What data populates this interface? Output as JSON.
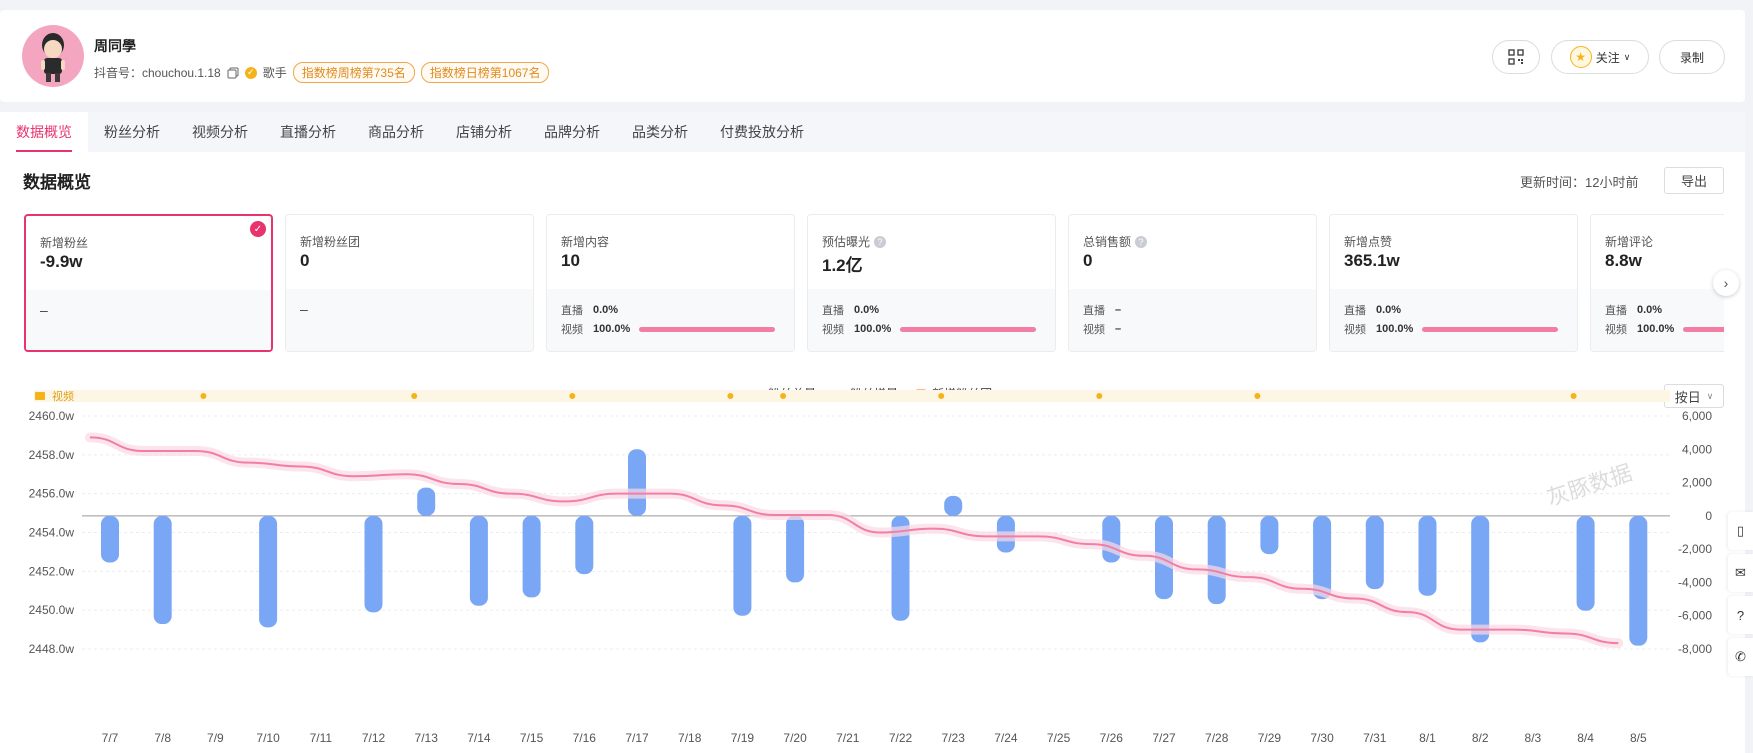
{
  "profile": {
    "name": "周同學",
    "douyin_id": "抖音号：chouchou.1.18",
    "role": "歌手",
    "rank_weekly": "指数榜周榜第735名",
    "rank_daily": "指数榜日榜第1067名",
    "follow_label": "关注",
    "record_label": "录制"
  },
  "tabs": [
    "数据概览",
    "粉丝分析",
    "视频分析",
    "直播分析",
    "商品分析",
    "店铺分析",
    "品牌分析",
    "品类分析",
    "付费投放分析"
  ],
  "overview": {
    "title": "数据概览",
    "update_time": "更新时间：12小时前",
    "export_label": "导出",
    "cards": [
      {
        "label": "新增粉丝",
        "value": "-9.9w",
        "bottom": "–",
        "help": false
      },
      {
        "label": "新增粉丝团",
        "value": "0",
        "bottom": "–",
        "help": false
      },
      {
        "label": "新增内容",
        "value": "10",
        "live_label": "直播",
        "live": "0.0%",
        "video_label": "视频",
        "video": "100.0%",
        "help": false,
        "bar": true
      },
      {
        "label": "预估曝光",
        "value": "1.2亿",
        "live_label": "直播",
        "live": "0.0%",
        "video_label": "视频",
        "video": "100.0%",
        "help": true,
        "bar": true
      },
      {
        "label": "总销售额",
        "value": "0",
        "live_label": "直播",
        "live": "–",
        "video_label": "视频",
        "video": "–",
        "help": true,
        "bar": false
      },
      {
        "label": "新增点赞",
        "value": "365.1w",
        "live_label": "直播",
        "live": "0.0%",
        "video_label": "视频",
        "video": "100.0%",
        "help": false,
        "bar": true
      },
      {
        "label": "新增评论",
        "value": "8.8w",
        "live_label": "直播",
        "live": "0.0%",
        "video_label": "视频",
        "video": "100.0%",
        "help": false,
        "bar": true
      }
    ]
  },
  "legend": {
    "total": "粉丝总量",
    "increase": "粉丝增量",
    "fan_club": "新增粉丝团"
  },
  "period_select": "按日",
  "colors": {
    "accent": "#e8336d",
    "line": "#f27ea4",
    "bar": "#7aa7f5",
    "video_band": "#fef6e4",
    "video_dot": "#f5b31b"
  },
  "chart_data": {
    "type": "bar+line",
    "video_track_label": "视频",
    "video_dates": [
      "7/9",
      "7/13",
      "7/16",
      "7/19",
      "7/20",
      "7/23",
      "7/26",
      "7/29",
      "8/4"
    ],
    "x": [
      "7/7",
      "7/8",
      "7/9",
      "7/10",
      "7/11",
      "7/12",
      "7/13",
      "7/14",
      "7/15",
      "7/16",
      "7/17",
      "7/18",
      "7/19",
      "7/20",
      "7/21",
      "7/22",
      "7/23",
      "7/24",
      "7/25",
      "7/26",
      "7/27",
      "7/28",
      "7/29",
      "7/30",
      "7/31",
      "8/1",
      "8/2",
      "8/3",
      "8/4",
      "8/5"
    ],
    "series": [
      {
        "name": "粉丝总量",
        "axis": "left",
        "unit": "w",
        "values": [
          2458.9,
          2458.2,
          2458.2,
          2457.6,
          2457.4,
          2456.9,
          2457.0,
          2456.5,
          2456.0,
          2455.6,
          2456.0,
          2456.0,
          2455.4,
          2454.9,
          2454.9,
          2454.0,
          2454.2,
          2453.8,
          2453.8,
          2453.4,
          2452.8,
          2452.1,
          2451.7,
          2451.1,
          2450.6,
          2449.9,
          2449.0,
          2449.0,
          2448.8,
          2448.3
        ]
      },
      {
        "name": "粉丝增量",
        "axis": "right",
        "values": [
          -2800,
          -6500,
          0,
          -6700,
          0,
          -5800,
          1700,
          -5400,
          -4900,
          -3500,
          4000,
          0,
          -6000,
          -4000,
          0,
          -6300,
          1200,
          -2200,
          0,
          -2800,
          -5000,
          -5300,
          -2300,
          -5000,
          -4400,
          -4800,
          -7600,
          0,
          -5700,
          -7800
        ]
      }
    ],
    "left_axis": {
      "ticks": [
        "2460.0w",
        "2458.0w",
        "2456.0w",
        "2454.0w",
        "2452.0w",
        "2450.0w",
        "2448.0w"
      ],
      "min": 2448.0,
      "max": 2460.0
    },
    "right_axis": {
      "ticks": [
        "6,000",
        "4,000",
        "2,000",
        "0",
        "-2,000",
        "-4,000",
        "-6,000",
        "-8,000"
      ],
      "min": -8000,
      "max": 6000
    },
    "watermark": "灰豚数据"
  }
}
